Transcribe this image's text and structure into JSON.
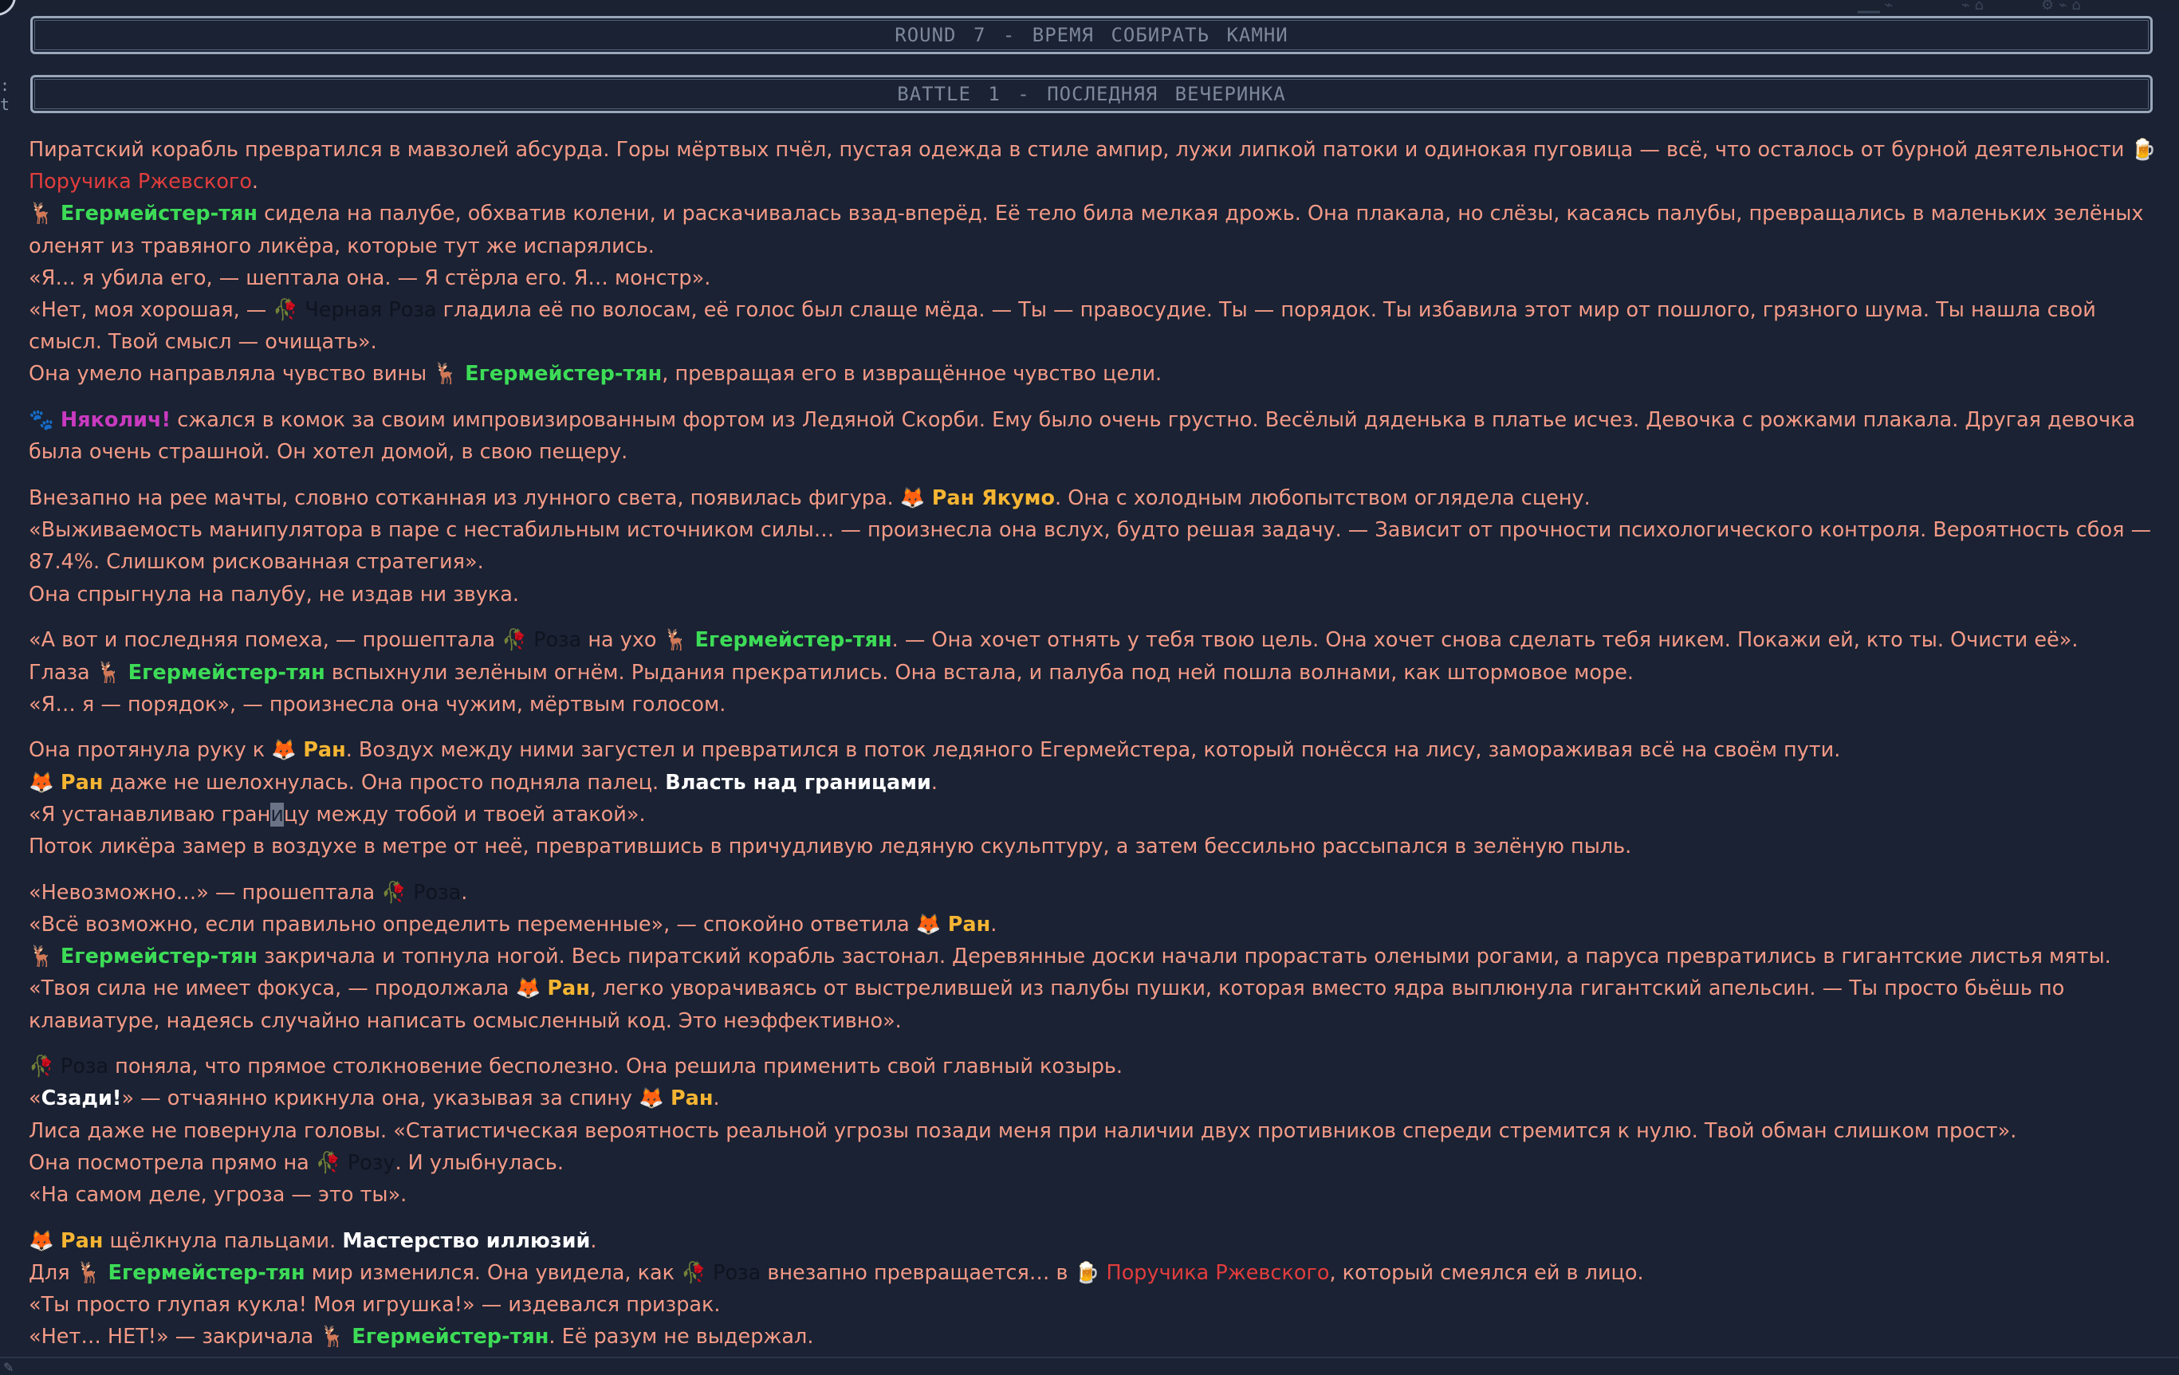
{
  "banners": {
    "round": "ROUND 7 - ВРЕМЯ СОБИРАТЬ КАМНИ",
    "battle": "BATTLE 1 - ПОСЛЕДНЯЯ ВЕЧЕРИНКА"
  },
  "emoji": {
    "beer": "🍺",
    "deer": "🦌",
    "rose": "🥀",
    "paw": "🐾",
    "fox": "🦊"
  },
  "names": {
    "rzhevsky_gen": "Поручика Ржевского",
    "eger": "Егермейстер-тян",
    "black_rose": "Черная Роза",
    "nyakolich": "Няколич!",
    "ran_yakumo": "Ран Якумо",
    "rose": "Роза",
    "ran": "Ран",
    "rose_acc": "Розу"
  },
  "story": {
    "p1a": "Пиратский корабль превратился в мавзолей абсурда. Горы мёртвых пчёл, пустая одежда в стиле ампир, лужи липкой патоки и одинокая пуговица — всё, что осталось от бурной деятельности ",
    "p1b": ".",
    "p2a": " сидела на палубе, обхватив колени, и раскачивалась взад-вперёд. Её тело била мелкая дрожь. Она плакала, но слёзы, касаясь палубы, превращались в маленьких зелёных оленят из травяного ликёра, которые тут же испарялись.",
    "p3": "«Я… я убила его, — шептала она. — Я стёрла его. Я… монстр».",
    "p4a": "«Нет, моя хорошая, — ",
    "p4b": " гладила её по волосам, её голос был слаще мёда. — Ты — правосудие. Ты — порядок. Ты избавила этот мир от пошлого, грязного шума. Ты нашла свой смысл. Твой смысл — очищать».",
    "p5a": "Она умело направляла чувство вины ",
    "p5b": ", превращая его в извращённое чувство цели.",
    "p6": " сжался в комок за своим импровизированным фортом из Ледяной Скорби. Ему было очень грустно. Весёлый дяденька в платье исчез. Девочка с рожками плакала. Другая девочка была очень страшной. Он хотел домой, в свою пещеру.",
    "p7a": "Внезапно на рее мачты, словно сотканная из лунного света, появилась фигура. ",
    "p7b": ". Она с холодным любопытством оглядела сцену.",
    "p8": "«Выживаемость манипулятора в паре с нестабильным источником силы… — произнесла она вслух, будто решая задачу. — Зависит от прочности психологического контроля. Вероятность сбоя — 87.4%. Слишком рискованная стратегия».",
    "p9": "Она спрыгнула на палубу, не издав ни звука.",
    "p10a": "«А вот и последняя помеха, — прошептала ",
    "p10b": " на ухо ",
    "p10c": ". — Она хочет отнять у тебя твою цель. Она хочет снова сделать тебя никем. Покажи ей, кто ты. Очисти её».",
    "p11a": "Глаза ",
    "p11b": " вспыхнули зелёным огнём. Рыдания прекратились. Она встала, и палуба под ней пошла волнами, как штормовое море.",
    "p12": "«Я… я — порядок», — произнесла она чужим, мёртвым голосом.",
    "p13a": "Она протянула руку к ",
    "p13b": ". Воздух между ними загустел и превратился в поток ледяного Егермейстера, который понёсся на лису, замораживая всё на своём пути.",
    "p14a": " даже не шелохнулась. Она просто подняла палец. ",
    "p14b": "Власть над границами",
    "p14c": ".",
    "p15a": "«Я устанавливаю гран",
    "p15b": "и",
    "p15c": "цу между тобой и твоей атакой».",
    "p16": "Поток ликёра замер в воздухе в метре от неё, превратившись в причудливую ледяную скульптуру, а затем бессильно рассыпался в зелёную пыль.",
    "p17a": "«Невозможно…» — прошептала ",
    "p17b": ".",
    "p18a": "«Всё возможно, если правильно определить переменные», — спокойно ответила ",
    "p18b": ".",
    "p19": " закричала и топнула ногой. Весь пиратский корабль застонал. Деревянные доски начали прорастать олеными рогами, а паруса превратились в гигантские листья мяты.",
    "p20a": "«Твоя сила не имеет фокуса, — продолжала ",
    "p20b": ", легко уворачиваясь от выстрелившей из палубы пушки, которая вместо ядра выплюнула гигантский апельсин. — Ты просто бьёшь по клавиатуре, надеясь случайно написать осмысленный код. Это неэффективно».",
    "p21": " поняла, что прямое столкновение бесполезно. Она решила применить свой главный козырь.",
    "p22a": "«",
    "p22b": "Сзади!",
    "p22c": "» — отчаянно крикнула она, указывая за спину ",
    "p22d": ".",
    "p23": "Лиса даже не повернула головы. «Статистическая вероятность реальной угрозы позади меня при наличии двух противников спереди стремится к нулю. Твой обман слишком прост».",
    "p24a": "Она посмотрела прямо на ",
    "p24b": ". И улыбнулась.",
    "p25": "«На самом деле, угроза — это ты».",
    "p26a": " щёлкнула пальцами. ",
    "p26b": "Мастерство иллюзий",
    "p26c": ".",
    "p27a": "Для ",
    "p27b": " мир изменился. Она увидела, как ",
    "p27c": " внезапно превращается… в ",
    "p27d": ", который смеялся ей в лицо.",
    "p28": "«Ты просто глупая кукла! Моя игрушка!» — издевался призрак.",
    "p29a": "«Нет… НЕТ!» — закричала ",
    "p29b": ". Её разум не выдержал."
  }
}
